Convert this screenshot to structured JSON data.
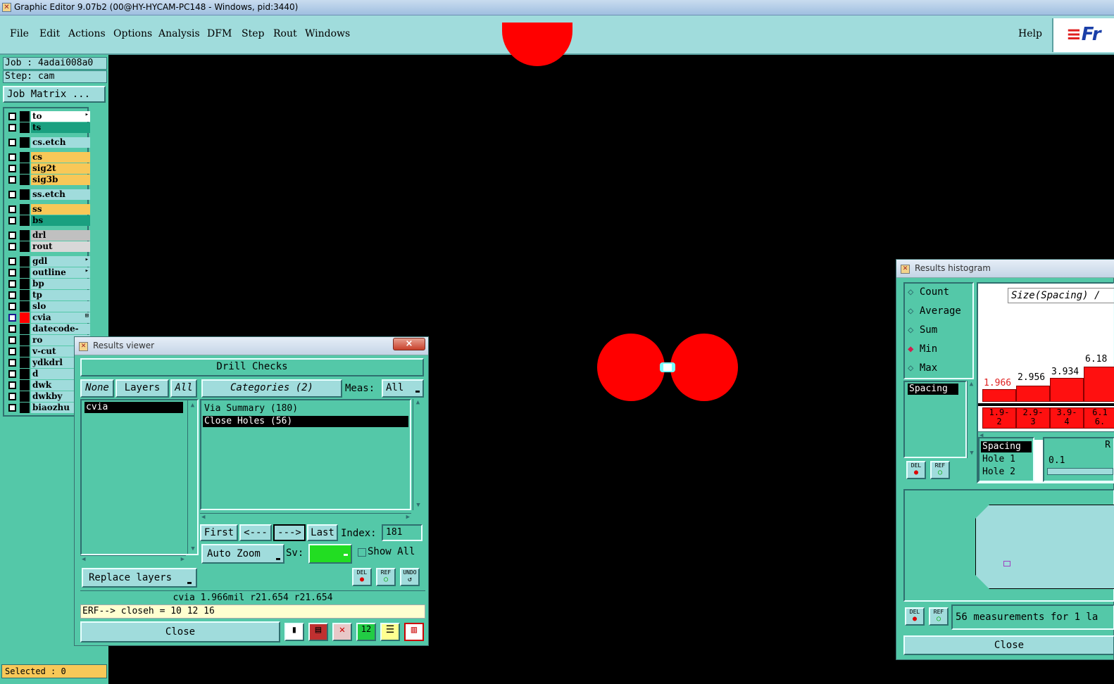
{
  "window": {
    "title": "Graphic Editor 9.07b2 (00@HY-HYCAM-PC148 - Windows, pid:3440)"
  },
  "menu": {
    "items": [
      "File",
      "Edit",
      "Actions",
      "Options",
      "Analysis",
      "DFM",
      "Step",
      "Rout",
      "Windows"
    ],
    "help": "Help",
    "logo": "Fr"
  },
  "sidebar": {
    "job": "Job : 4adai008a0",
    "step": "Step: cam",
    "job_matrix": "Job Matrix ...",
    "layers": [
      {
        "name": "to",
        "color": "#ffffff",
        "mark": "▸"
      },
      {
        "name": "ts",
        "color": "#1aa080",
        "mark": ""
      },
      {
        "name": "cs.etch",
        "color": "#a0dcdc",
        "mark": ""
      },
      {
        "name": "cs",
        "color": "#f8c858",
        "mark": ""
      },
      {
        "name": "sig2t",
        "color": "#f8c858",
        "mark": ""
      },
      {
        "name": "sig3b",
        "color": "#f8c858",
        "mark": ""
      },
      {
        "name": "ss.etch",
        "color": "#a0dcdc",
        "mark": ""
      },
      {
        "name": "ss",
        "color": "#f8c858",
        "mark": ""
      },
      {
        "name": "bs",
        "color": "#1aa080",
        "mark": ""
      },
      {
        "name": "drl",
        "color": "#c0c0c0",
        "mark": ""
      },
      {
        "name": "rout",
        "color": "#d8d8d8",
        "mark": ""
      },
      {
        "name": "gdl",
        "color": "#a0dcdc",
        "mark": "▸"
      },
      {
        "name": "outline",
        "color": "#a0dcdc",
        "mark": "▸"
      },
      {
        "name": "bp",
        "color": "#a0dcdc",
        "mark": ""
      },
      {
        "name": "tp",
        "color": "#a0dcdc",
        "mark": ""
      },
      {
        "name": "slo",
        "color": "#a0dcdc",
        "mark": ""
      },
      {
        "name": "cvia",
        "color": "#a0dcdc",
        "mark": "⊞"
      },
      {
        "name": "datecode-ptc",
        "color": "#a0dcdc",
        "mark": ""
      },
      {
        "name": "ro",
        "color": "#a0dcdc",
        "mark": ""
      },
      {
        "name": "v-cut",
        "color": "#a0dcdc",
        "mark": ""
      },
      {
        "name": "ydkdrl",
        "color": "#a0dcdc",
        "mark": ""
      },
      {
        "name": "d",
        "color": "#a0dcdc",
        "mark": ""
      },
      {
        "name": "dwk",
        "color": "#a0dcdc",
        "mark": ""
      },
      {
        "name": "dwkby",
        "color": "#a0dcdc",
        "mark": ""
      },
      {
        "name": "biaozhu",
        "color": "#a0dcdc",
        "mark": ""
      }
    ],
    "selected": "Selected : 0"
  },
  "results_viewer": {
    "title": "Results viewer",
    "close_x": "×",
    "header": "Drill Checks",
    "none_btn": "None",
    "layers_btn": "Layers",
    "all_btn": "All",
    "categories_btn": "Categories (2)",
    "meas_label": "Meas:",
    "meas_value": "All",
    "layer_items": [
      "cvia"
    ],
    "category_items": [
      "Via Summary (180)",
      "Close Holes (56)"
    ],
    "first_btn": "First",
    "prev_btn": "<---",
    "next_btn": "--->",
    "last_btn": "Last",
    "index_label": "Index:",
    "index_value": "181",
    "auto_zoom": "Auto Zoom",
    "sv_label": "Sv:",
    "show_all": "Show All",
    "replace_layers": "Replace layers",
    "del_label": "DEL",
    "ref_label": "REF",
    "undo_label": "UNDO",
    "status_line": "cvia 1.966mil  r21.654  r21.654",
    "erf_line": "ERF--> closeh = 10 12 16",
    "close_btn": "Close",
    "sv_color": "#22dd22"
  },
  "results_histogram": {
    "title": "Results histogram",
    "modes": [
      "Count",
      "Average",
      "Sum",
      "Min",
      "Max"
    ],
    "selected_mode": "Min",
    "axis_title": "Size(Spacing) /",
    "list_item": "Spacing",
    "bar_values": [
      "1.966",
      "2.956",
      "3.934",
      "6.18"
    ],
    "bin_labels": [
      "1.9-\n2",
      "2.9-\n3",
      "3.9-\n4",
      "6.1\n6."
    ],
    "detail_items": [
      "Spacing",
      "Hole 1",
      "Hole 2"
    ],
    "detail_right_label": "R",
    "detail_value": "0.1",
    "del_label": "DEL",
    "ref_label": "REF",
    "status": "56 measurements for 1 la",
    "close_btn": "Close"
  }
}
